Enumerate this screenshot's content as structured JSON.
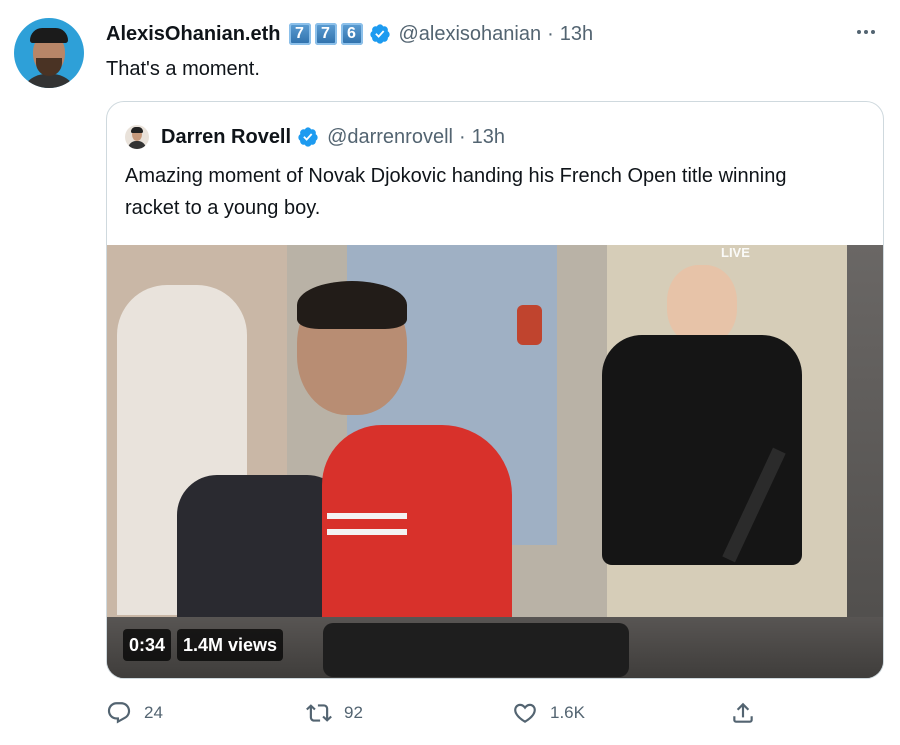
{
  "tweet": {
    "author_name": "AlexisOhanian.eth",
    "emoji_keys": [
      "7",
      "7",
      "6"
    ],
    "handle": "@alexisohanian",
    "separator": "·",
    "time": "13h",
    "text": "That's a moment."
  },
  "quoted_tweet": {
    "author_name": "Darren Rovell",
    "handle": "@darrenrovell",
    "separator": "·",
    "time": "13h",
    "text": "Amazing moment of Novak Djokovic handing his French Open title winning racket to a young boy."
  },
  "video": {
    "duration": "0:34",
    "views": "1.4M views",
    "overlay_live": "LIVE"
  },
  "actions": {
    "reply_count": "24",
    "retweet_count": "92",
    "like_count": "1.6K"
  },
  "icons": {
    "verified": "verified-badge-icon",
    "more": "more-icon",
    "reply": "reply-icon",
    "retweet": "retweet-icon",
    "like": "like-icon",
    "share": "share-icon"
  },
  "colors": {
    "verified_blue": "#1d9bf0",
    "secondary_text": "#536471",
    "border": "#cfd9de"
  }
}
